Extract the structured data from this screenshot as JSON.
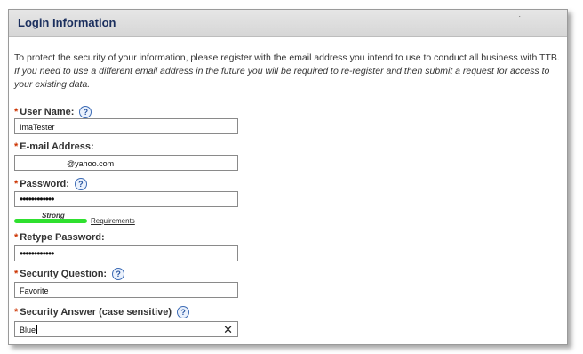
{
  "header": {
    "title": "Login Information",
    "corner_mark": "."
  },
  "intro": {
    "normal": "To protect the security of your information, please register with the email address you intend to use to conduct all business with TTB.",
    "italic": "If you need to use a different email address in the future you will be required to re-register and then submit a request for access to your existing data."
  },
  "required_marker": "*",
  "help_glyph": "?",
  "fields": {
    "username": {
      "label": "User Name:",
      "value": "ImaTester"
    },
    "email": {
      "label": "E-mail Address:",
      "value": "@yahoo.com"
    },
    "password": {
      "label": "Password:",
      "value": "••••••••••••"
    },
    "strength": {
      "label": "Strong",
      "requirements_link": "Requirements",
      "level": 1.0,
      "color": "#2fe02f"
    },
    "retype": {
      "label": "Retype Password:",
      "value": "••••••••••••"
    },
    "question": {
      "label": "Security Question:",
      "value": "Favorite"
    },
    "answer": {
      "label": "Security Answer (case sensitive)",
      "value": "Blue",
      "clear_icon": "✕"
    }
  },
  "colors": {
    "title": "#1b2f5e",
    "required": "#cc3300",
    "help": "#2855a0"
  }
}
